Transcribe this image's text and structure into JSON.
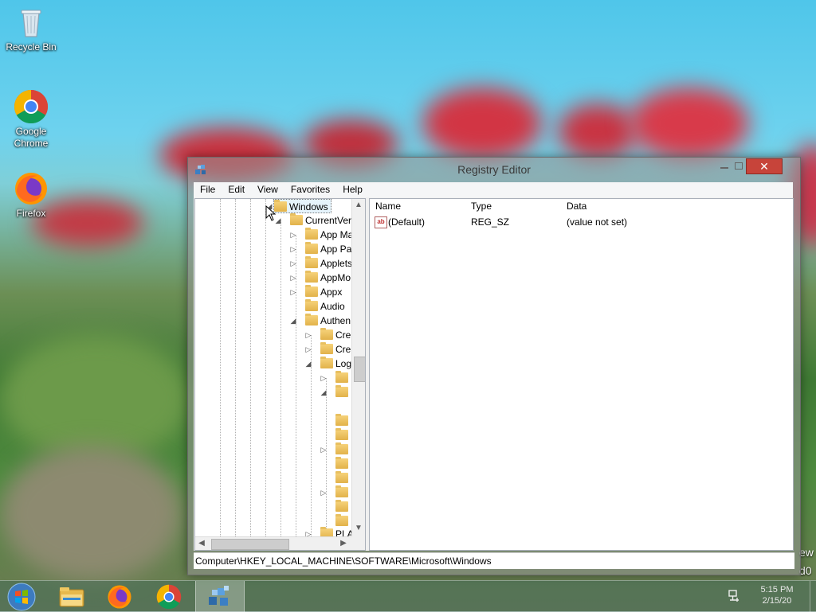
{
  "desktop": {
    "icons": [
      {
        "label": "Recycle Bin",
        "icon": "recycle-bin-icon"
      },
      {
        "label": "Google Chrome",
        "icon": "chrome-icon"
      },
      {
        "label": "Firefox",
        "icon": "firefox-icon"
      }
    ],
    "edge_text": [
      "ew",
      "d0"
    ]
  },
  "window": {
    "title": "Registry Editor",
    "menu": [
      "File",
      "Edit",
      "View",
      "Favorites",
      "Help"
    ],
    "tree": {
      "selected": "Windows",
      "rows": [
        {
          "label": "Windows",
          "expander": "collapse"
        },
        {
          "label": "CurrentVer",
          "expander": "collapse"
        },
        {
          "label": "App Ma",
          "expander": "expand"
        },
        {
          "label": "App Pa",
          "expander": "expand"
        },
        {
          "label": "Applets",
          "expander": "expand"
        },
        {
          "label": "AppMo",
          "expander": "expand"
        },
        {
          "label": "Appx",
          "expander": "expand"
        },
        {
          "label": "Audio",
          "expander": "none"
        },
        {
          "label": "Authen",
          "expander": "collapse"
        },
        {
          "label": "Cre",
          "expander": "expand"
        },
        {
          "label": "Cre",
          "expander": "expand"
        },
        {
          "label": "Log",
          "expander": "collapse"
        },
        {
          "label": "PLA",
          "expander": "expand"
        }
      ]
    },
    "columns": {
      "name": "Name",
      "type": "Type",
      "data": "Data"
    },
    "values": [
      {
        "name": "(Default)",
        "type": "REG_SZ",
        "data": "(value not set)"
      }
    ],
    "status_path": "Computer\\HKEY_LOCAL_MACHINE\\SOFTWARE\\Microsoft\\Windows"
  },
  "taskbar": {
    "items": [
      "start-button",
      "file-explorer",
      "firefox",
      "chrome",
      "registry-editor"
    ],
    "clock_time": "5:15 PM",
    "clock_date": "2/15/20"
  }
}
